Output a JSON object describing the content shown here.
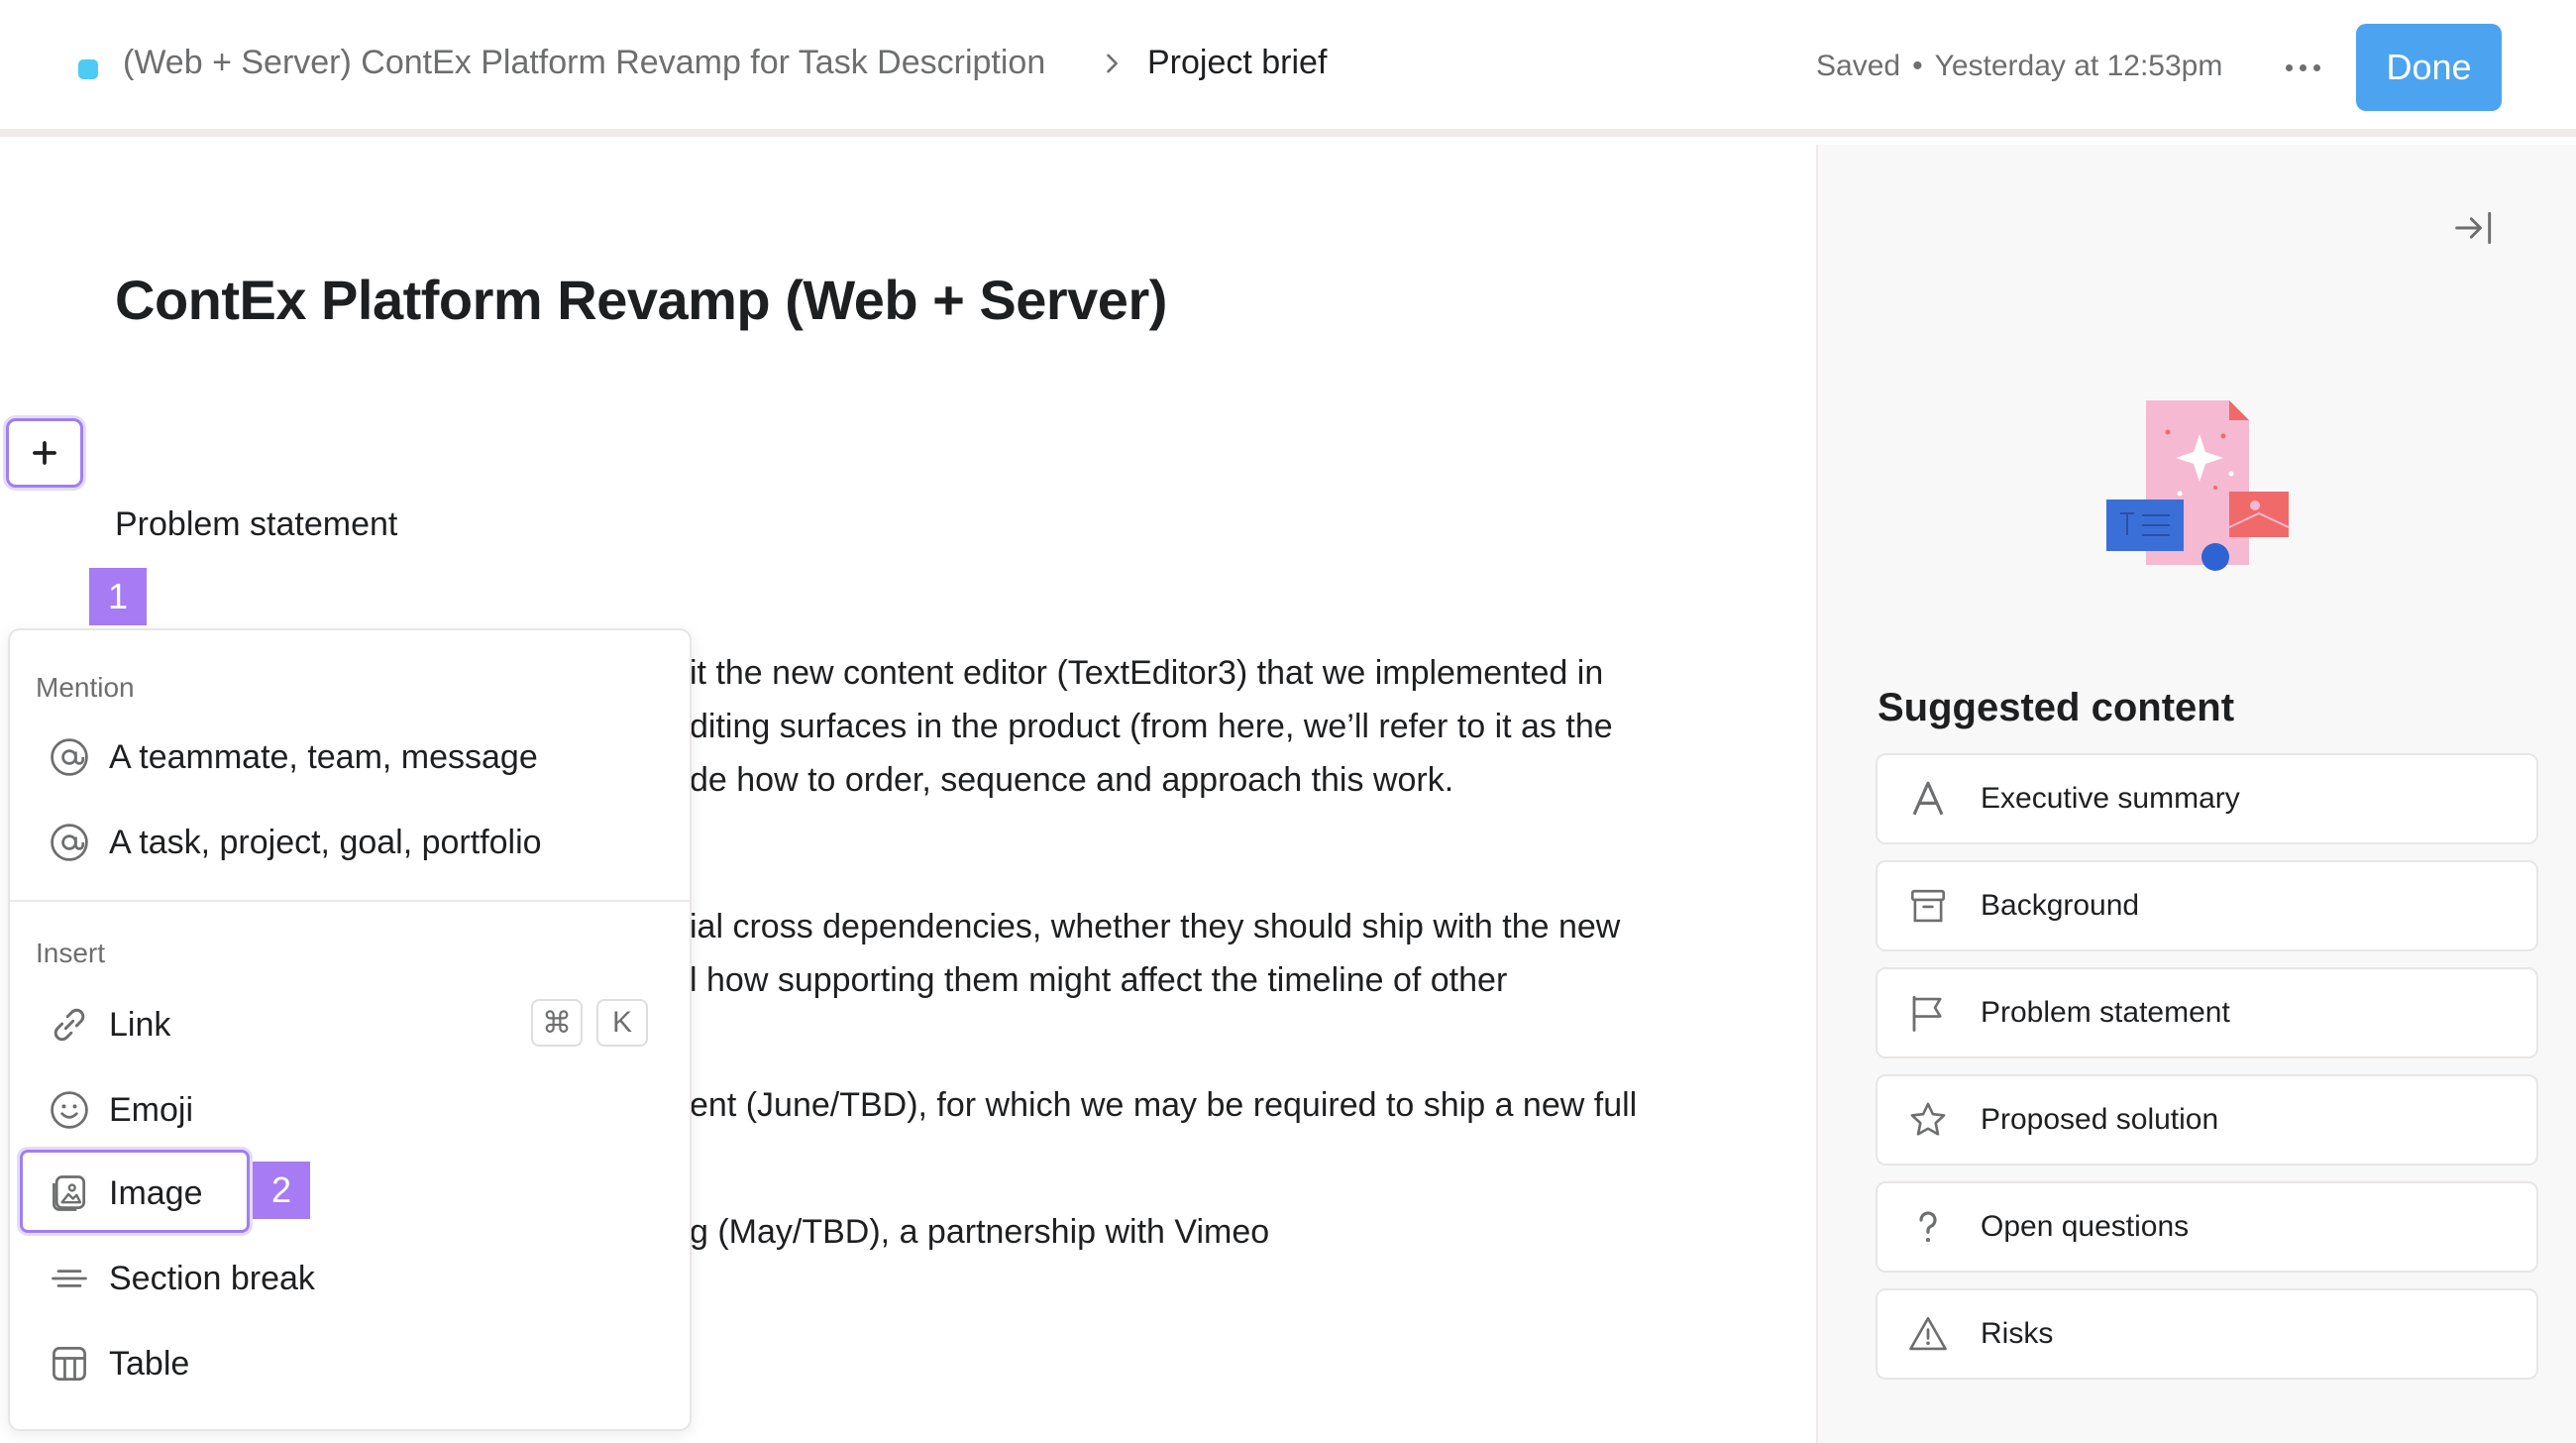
{
  "topbar": {
    "project_name": "(Web + Server) ContEx Platform Revamp for Task Description",
    "current_page": "Project brief",
    "saved_label": "Saved",
    "saved_time": "Yesterday at 12:53pm",
    "done_label": "Done",
    "project_color": "#4ecbf2",
    "done_color": "#4ca4f0"
  },
  "document": {
    "title": "ContEx Platform Revamp (Web + Server)",
    "section_heading": "Problem statement",
    "lines": [
      "it the new content editor (TextEditor3) that we implemented in",
      "diting surfaces in the product (from here, we’ll refer to it as the",
      "de how to order, sequence and approach this work.",
      "ial cross dependencies, whether they should ship with the new",
      "l how supporting them might affect the timeline of other",
      "ent (June/TBD), for which we may be required to ship a new full",
      "g (May/TBD), a partnership with Vimeo"
    ]
  },
  "plus_button": {
    "label": "+",
    "badge": "1"
  },
  "menu": {
    "mention_section": "Mention",
    "mention_items": [
      {
        "label": "A teammate, team, message",
        "icon": "at-icon"
      },
      {
        "label": "A task, project, goal, portfolio",
        "icon": "at-icon"
      }
    ],
    "insert_section": "Insert",
    "insert_items": [
      {
        "label": "Link",
        "icon": "link-icon",
        "shortcut": [
          "⌘",
          "K"
        ]
      },
      {
        "label": "Emoji",
        "icon": "smiley-icon"
      },
      {
        "label": "Image",
        "icon": "image-icon",
        "badge": "2"
      },
      {
        "label": "Section break",
        "icon": "section-break-icon"
      },
      {
        "label": "Table",
        "icon": "table-icon"
      }
    ]
  },
  "right_panel": {
    "suggested_title": "Suggested content",
    "items": [
      {
        "label": "Executive summary",
        "icon": "letter-a-icon"
      },
      {
        "label": "Background",
        "icon": "archive-box-icon"
      },
      {
        "label": "Problem statement",
        "icon": "flag-icon"
      },
      {
        "label": "Proposed solution",
        "icon": "star-icon"
      },
      {
        "label": "Open questions",
        "icon": "question-mark-icon"
      },
      {
        "label": "Risks",
        "icon": "warning-triangle-icon"
      }
    ]
  },
  "colors": {
    "accent_purple": "#a77bf3",
    "text_primary": "#1e1f21",
    "text_secondary": "#6d6e6f"
  }
}
